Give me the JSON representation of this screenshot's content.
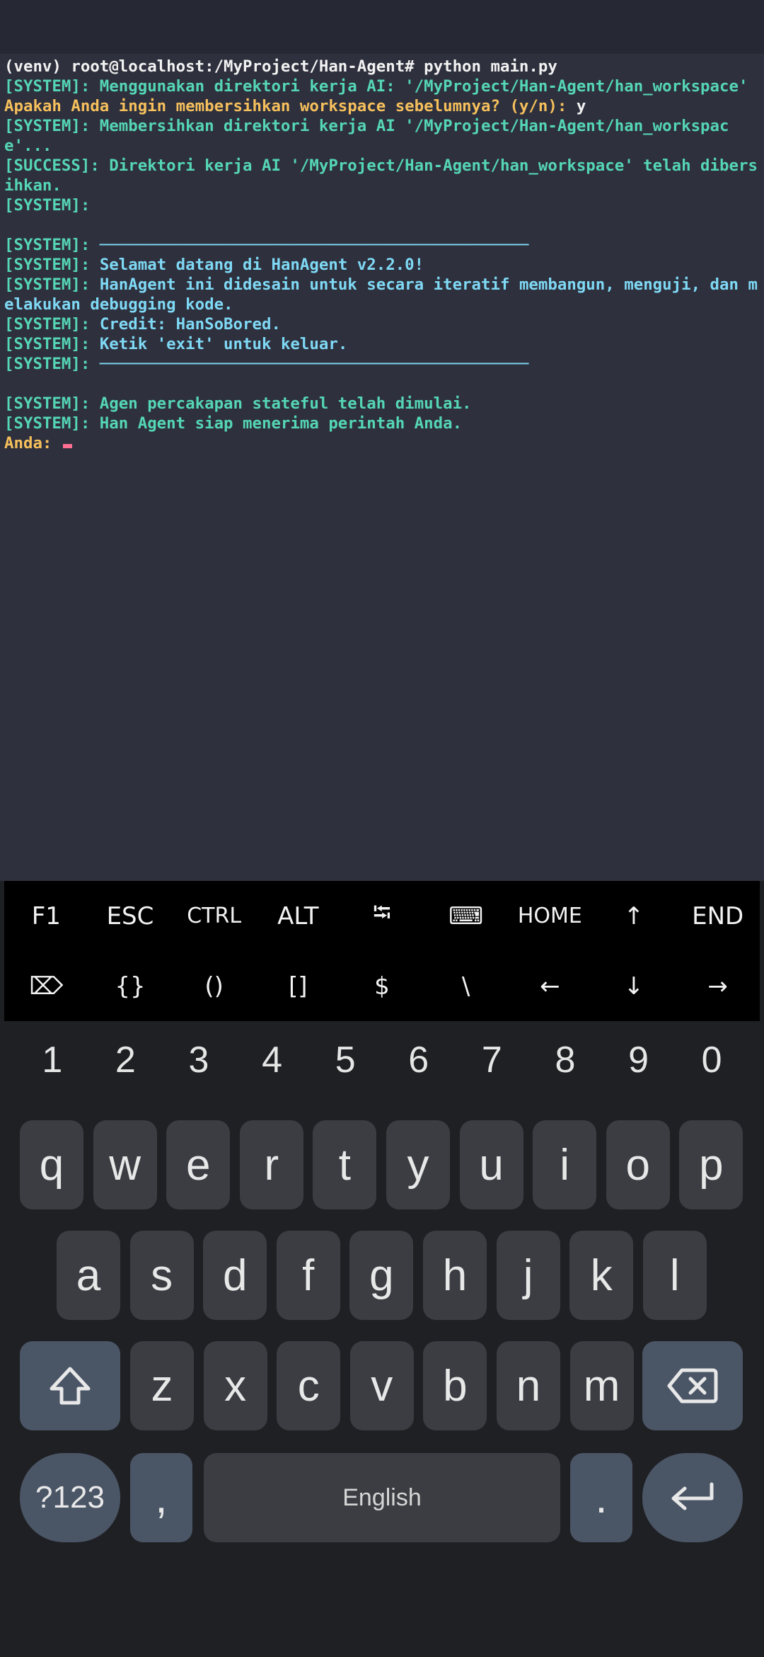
{
  "terminal": {
    "lines": [
      {
        "color": "white",
        "text": "(venv) root@localhost:/MyProject/Han-Agent# python main.py"
      },
      {
        "color": "teal",
        "text": "[SYSTEM]: Menggunakan direktori kerja AI: '/MyProject/Han-Agent/han_workspace'"
      },
      {
        "color": "yellow",
        "text": "Apakah Anda ingin membersihkan workspace sebelumnya? (y/n): ",
        "input": "y"
      },
      {
        "color": "teal",
        "text": "[SYSTEM]: Membersihkan direktori kerja AI '/MyProject/Han-Agent/han_workspace'..."
      },
      {
        "color": "teal",
        "text": "[SUCCESS]: Direktori kerja AI '/MyProject/Han-Agent/han_workspace' telah dibersihkan."
      },
      {
        "color": "teal",
        "text": "[SYSTEM]: "
      },
      {
        "color": "teal",
        "text": ""
      },
      {
        "color": "teal",
        "text": "[SYSTEM]: ",
        "rest": "─────────────────────────────────────────────",
        "restColor": "cyan"
      },
      {
        "color": "teal",
        "text": "[SYSTEM]: ",
        "rest": "Selamat datang di HanAgent v2.2.0!",
        "restColor": "cyan"
      },
      {
        "color": "teal",
        "text": "[SYSTEM]: ",
        "rest": "HanAgent ini didesain untuk secara iteratif membangun, menguji, dan melakukan debugging kode.",
        "restColor": "cyan"
      },
      {
        "color": "teal",
        "text": "[SYSTEM]: ",
        "rest": "Credit: HanSoBored.",
        "restColor": "cyan"
      },
      {
        "color": "teal",
        "text": "[SYSTEM]: ",
        "rest": "Ketik 'exit' untuk keluar.",
        "restColor": "cyan"
      },
      {
        "color": "teal",
        "text": "[SYSTEM]: ",
        "rest": "─────────────────────────────────────────────",
        "restColor": "cyan"
      },
      {
        "color": "teal",
        "text": ""
      },
      {
        "color": "teal",
        "text": "[SYSTEM]: Agen percakapan stateful telah dimulai."
      },
      {
        "color": "teal",
        "text": "[SYSTEM]: Han Agent siap menerima perintah Anda."
      }
    ],
    "prompt": "Anda: "
  },
  "extra_keys": [
    {
      "name": "f1-key",
      "label": "F1"
    },
    {
      "name": "esc-key",
      "label": "ESC"
    },
    {
      "name": "ctrl-key",
      "label": "CTRL"
    },
    {
      "name": "alt-key",
      "label": "ALT"
    },
    {
      "name": "tab-key",
      "label": "⭾",
      "icon": "tab-icon"
    },
    {
      "name": "keyboard-toggle-key",
      "label": "⌨",
      "icon": "keyboard-icon"
    },
    {
      "name": "home-key",
      "label": "HOME"
    },
    {
      "name": "up-arrow-key",
      "label": "↑"
    },
    {
      "name": "end-key",
      "label": "END"
    },
    {
      "name": "delete-key",
      "label": "⌦",
      "icon": "delete-icon"
    },
    {
      "name": "braces-key",
      "label": "{}"
    },
    {
      "name": "parens-key",
      "label": "()"
    },
    {
      "name": "brackets-key",
      "label": "[]"
    },
    {
      "name": "dollar-key",
      "label": "$"
    },
    {
      "name": "backslash-key",
      "label": "\\"
    },
    {
      "name": "left-arrow-key",
      "label": "←"
    },
    {
      "name": "down-arrow-key",
      "label": "↓"
    },
    {
      "name": "right-arrow-key",
      "label": "→"
    }
  ],
  "keyboard": {
    "numbers": [
      "1",
      "2",
      "3",
      "4",
      "5",
      "6",
      "7",
      "8",
      "9",
      "0"
    ],
    "row1": [
      "q",
      "w",
      "e",
      "r",
      "t",
      "y",
      "u",
      "i",
      "o",
      "p"
    ],
    "row2": [
      "a",
      "s",
      "d",
      "f",
      "g",
      "h",
      "j",
      "k",
      "l"
    ],
    "row3": [
      "z",
      "x",
      "c",
      "v",
      "b",
      "n",
      "m"
    ],
    "symbols_label": "?123",
    "comma_label": ",",
    "space_label": "English",
    "period_label": ".",
    "icons": {
      "shift": "shift-icon",
      "backspace": "backspace-icon",
      "enter": "enter-icon"
    }
  },
  "colors": {
    "white": "#f2f2f2",
    "teal": "#55d6b5",
    "yellow": "#f6c05c",
    "cyan": "#7fd9f5",
    "cursor": "#ff6f91"
  }
}
